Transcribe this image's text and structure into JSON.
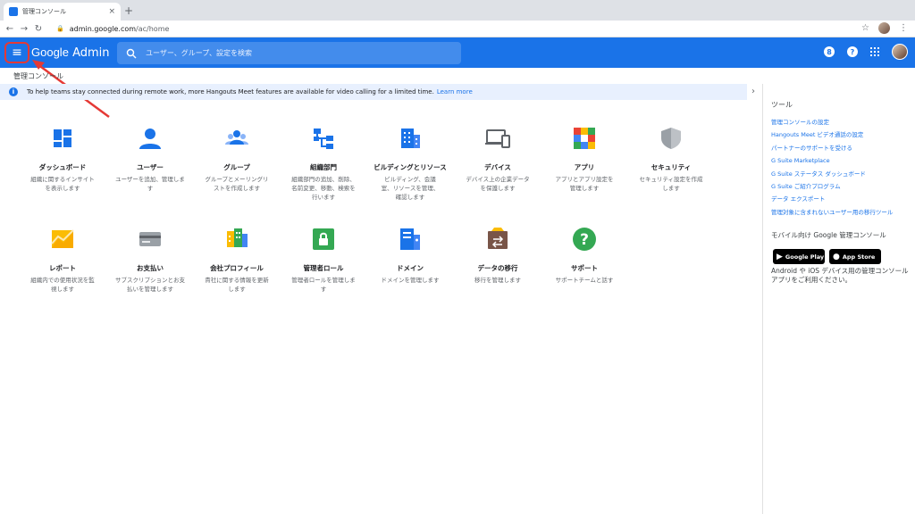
{
  "browser": {
    "tab_title": "管理コンソール",
    "tab_close": "×",
    "new_tab": "+",
    "url_host": "admin.google.com",
    "url_path": "/ac/home"
  },
  "header": {
    "logo_brand": "Google",
    "logo_product": "Admin",
    "search_placeholder": "ユーザー、グループ、設定を検索",
    "notification_count": "8",
    "help": "?"
  },
  "breadcrumb": "管理コンソール",
  "banner": {
    "text": "To help teams stay connected during remote work, more Hangouts Meet features are available for video calling for a limited time.",
    "link": "Learn more"
  },
  "tiles": [
    {
      "label": "ダッシュボード",
      "desc": "組織に関するインサイトを表示します",
      "icon": "dashboard-icon"
    },
    {
      "label": "ユーザー",
      "desc": "ユーザーを追加、管理します",
      "icon": "user-icon"
    },
    {
      "label": "グループ",
      "desc": "グループとメーリングリストを作成します",
      "icon": "group-icon"
    },
    {
      "label": "組織部門",
      "desc": "組織部門の追加、削除、名前変更、移動、検索を行います",
      "icon": "org-unit-icon"
    },
    {
      "label": "ビルディングとリソース",
      "desc": "ビルディング、会議室、リソースを管理、確認します",
      "icon": "building-icon"
    },
    {
      "label": "デバイス",
      "desc": "デバイス上の企業データを保護します",
      "icon": "devices-icon"
    },
    {
      "label": "アプリ",
      "desc": "アプリとアプリ設定を管理します",
      "icon": "apps-icon"
    },
    {
      "label": "セキュリティ",
      "desc": "セキュリティ設定を作成します",
      "icon": "shield-icon"
    },
    {
      "label": "レポート",
      "desc": "組織内での使用状況を監視します",
      "icon": "reports-icon"
    },
    {
      "label": "お支払い",
      "desc": "サブスクリプションとお支払いを管理します",
      "icon": "billing-icon"
    },
    {
      "label": "会社プロフィール",
      "desc": "貴社に関する情報を更新します",
      "icon": "company-profile-icon"
    },
    {
      "label": "管理者ロール",
      "desc": "管理者ロールを管理します",
      "icon": "admin-roles-icon"
    },
    {
      "label": "ドメイン",
      "desc": "ドメインを管理します",
      "icon": "domain-icon"
    },
    {
      "label": "データの移行",
      "desc": "移行を管理します",
      "icon": "data-migration-icon"
    },
    {
      "label": "サポート",
      "desc": "サポートチームと話す",
      "icon": "support-icon"
    }
  ],
  "side_panel": {
    "title": "ツール",
    "tools": [
      "管理コンソールの設定",
      "Hangouts Meet ビデオ通話の設定",
      "パートナーのサポートを受ける",
      "G Suite Marketplace",
      "G Suite ステータス ダッシュボード",
      "G Suite ご紹介プログラム",
      "データ エクスポート",
      "管理対象に含まれないユーザー用の移行ツール"
    ],
    "mobile_title": "モバイル向け Google 管理コンソール",
    "google_play": "Google Play",
    "app_store": "App Store",
    "mobile_desc": "Android や iOS デバイス用の管理コンソール アプリをご利用ください。"
  },
  "colors": {
    "brand_blue": "#1a73e8",
    "highlight_red": "#e53935"
  }
}
